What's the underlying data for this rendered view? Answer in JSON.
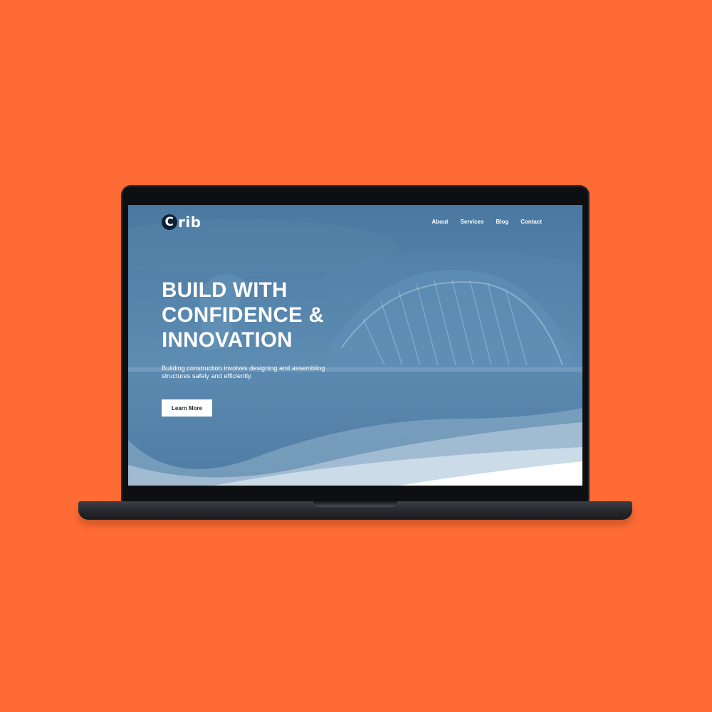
{
  "page": {
    "background_color": "#FF6B35"
  },
  "site": {
    "logo": {
      "mark": "C",
      "text": "rib"
    },
    "nav": [
      {
        "label": "About"
      },
      {
        "label": "Services"
      },
      {
        "label": "Blog"
      },
      {
        "label": "Contact"
      }
    ],
    "hero": {
      "headline_lines": [
        "BUILD WITH",
        "CONFIDENCE &",
        "INNOVATION"
      ],
      "subtext": "Building construction involves designing and assembling structures safely and efficiently.",
      "cta_label": "Learn More",
      "overlay_color": "#4f7da6"
    }
  }
}
